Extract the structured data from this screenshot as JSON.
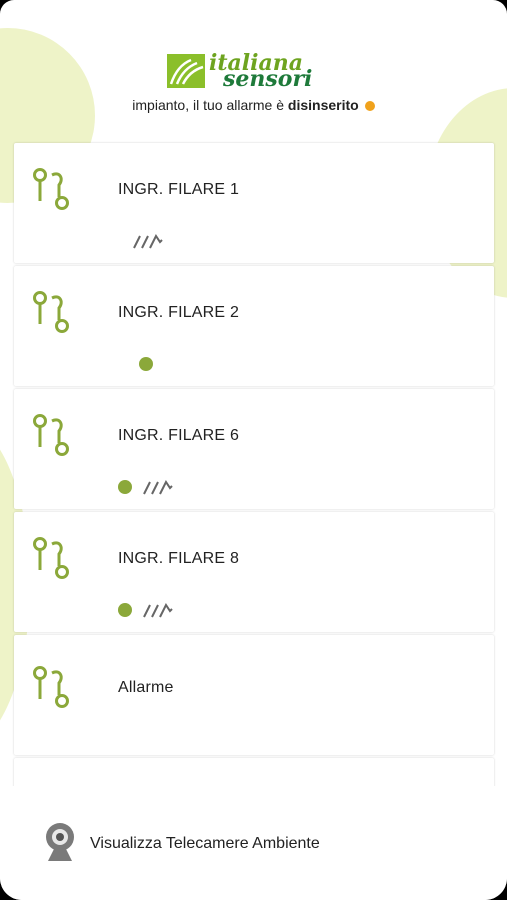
{
  "header": {
    "logo_line1": "italiana",
    "logo_line2": "sensori",
    "status_prefix": "impianto, il tuo allarme è ",
    "status_value": "disinserito",
    "status_color": "#f0a21c"
  },
  "zones": [
    {
      "label": "INGR. FILARE  1",
      "dot": false,
      "wave": true
    },
    {
      "label": "INGR. FILARE  2",
      "dot": true,
      "wave": false
    },
    {
      "label": "INGR. FILARE  6",
      "dot": true,
      "wave": true
    },
    {
      "label": "INGR. FILARE  8",
      "dot": true,
      "wave": true
    },
    {
      "label": "Allarme",
      "dot": false,
      "wave": false
    }
  ],
  "footer": {
    "camera_label": "Visualizza Telecamere Ambiente",
    "camera_icon": "webcam-icon"
  },
  "colors": {
    "accent_green": "#8ba83a",
    "background_blob": "#eef3c8"
  }
}
